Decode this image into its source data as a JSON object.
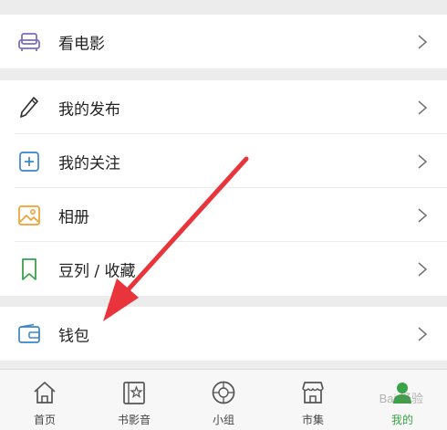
{
  "menu": {
    "movie_label": "看电影",
    "my_posts_label": "我的发布",
    "my_follows_label": "我的关注",
    "album_label": "相册",
    "doulist_label": "豆列 / 收藏",
    "wallet_label": "钱包"
  },
  "tabs": [
    {
      "label": "首页",
      "icon": "home-icon"
    },
    {
      "label": "书影音",
      "icon": "book-movie-music-icon"
    },
    {
      "label": "小组",
      "icon": "group-icon"
    },
    {
      "label": "市集",
      "icon": "market-icon"
    },
    {
      "label": "我的",
      "icon": "profile-icon"
    }
  ],
  "watermark": "Bai 经验",
  "colors": {
    "accent_green": "#3aa346",
    "annotation_red": "#e8343a",
    "album_orange": "#f0a030",
    "follow_blue": "#3a85c7",
    "movie_purple": "#7a6fb8"
  }
}
